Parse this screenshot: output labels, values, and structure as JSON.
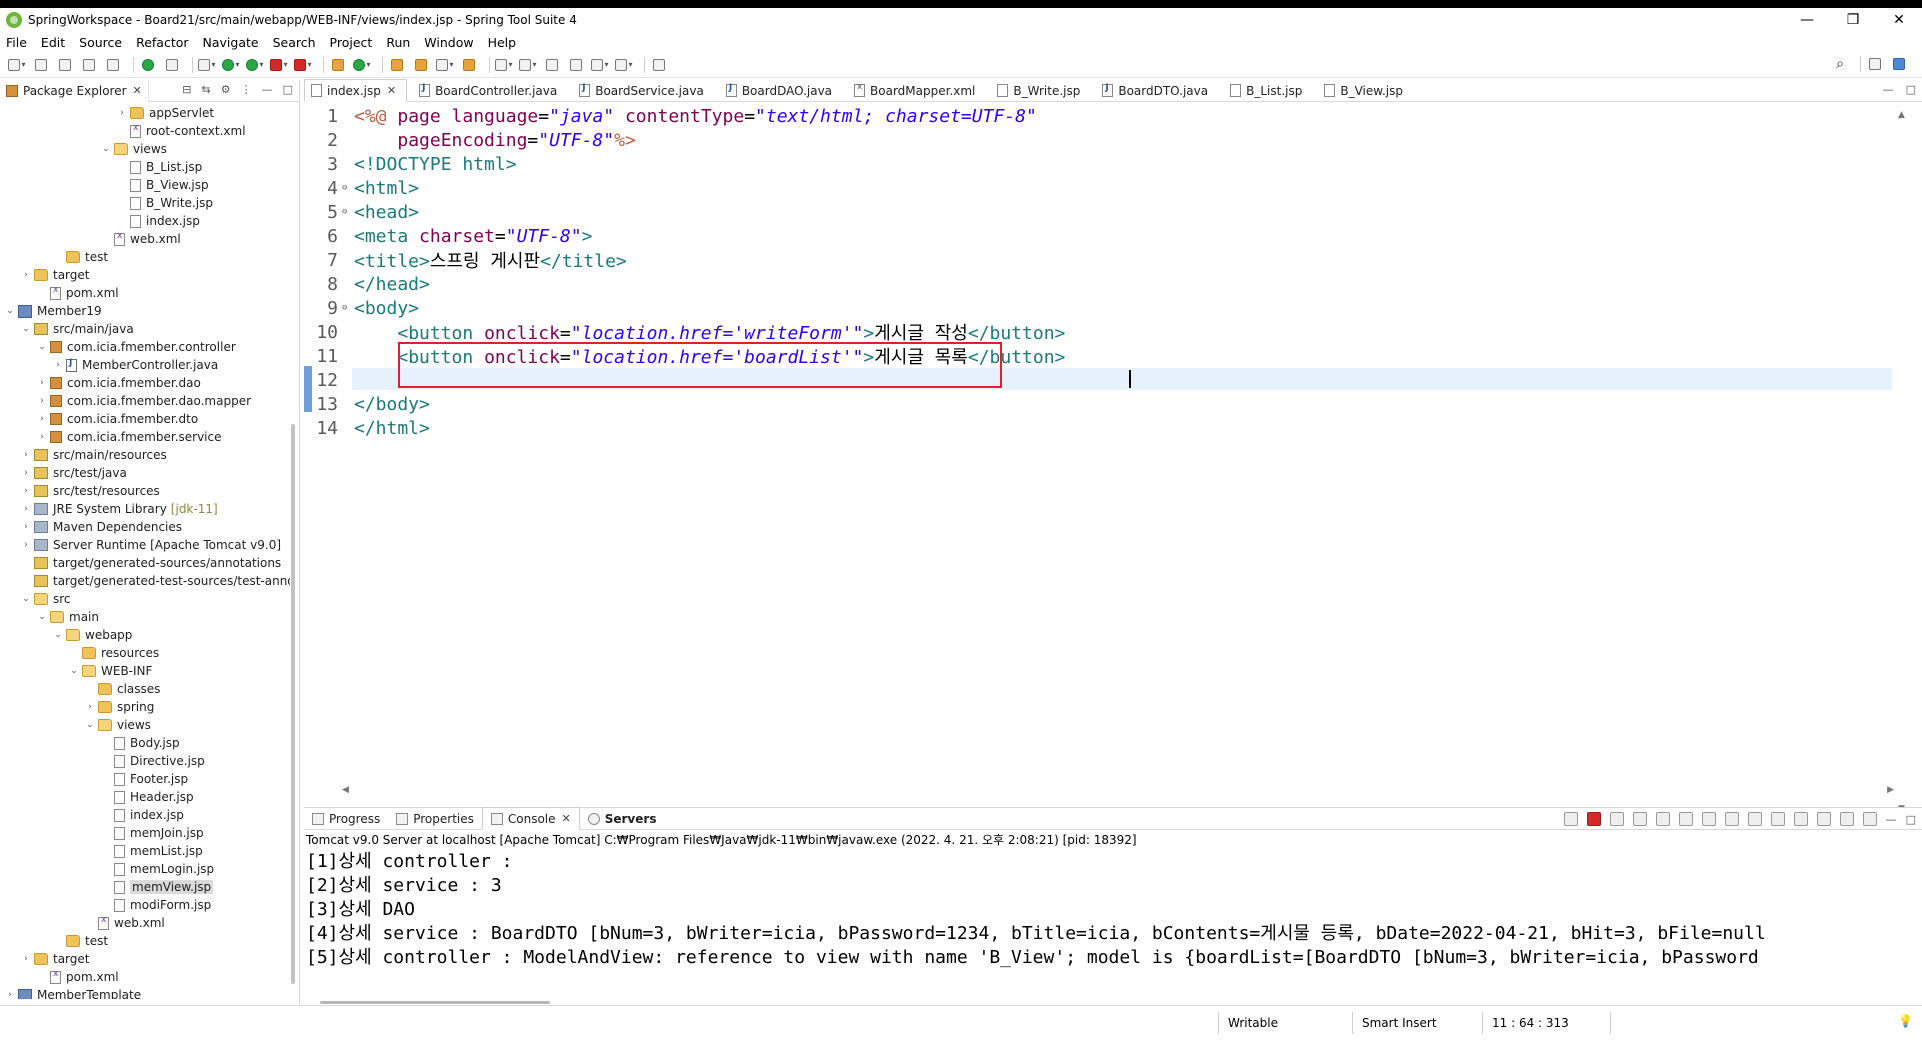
{
  "window": {
    "title": "SpringWorkspace - Board21/src/main/webapp/WEB-INF/views/index.jsp - Spring Tool Suite 4",
    "minimize": "—",
    "maximize": "❐",
    "close": "✕"
  },
  "menu": [
    "File",
    "Edit",
    "Source",
    "Refactor",
    "Navigate",
    "Search",
    "Project",
    "Run",
    "Window",
    "Help"
  ],
  "package_explorer": {
    "tab_label": "Package Explorer",
    "items": [
      {
        "label": "appServlet",
        "indent": 7,
        "twisty": "›",
        "icon": "folder"
      },
      {
        "label": "root-context.xml",
        "indent": 7,
        "twisty": "",
        "icon": "xml"
      },
      {
        "label": "views",
        "indent": 6,
        "twisty": "⌄",
        "icon": "folder-open"
      },
      {
        "label": "B_List.jsp",
        "indent": 7,
        "twisty": "",
        "icon": "file"
      },
      {
        "label": "B_View.jsp",
        "indent": 7,
        "twisty": "",
        "icon": "file"
      },
      {
        "label": "B_Write.jsp",
        "indent": 7,
        "twisty": "",
        "icon": "file"
      },
      {
        "label": "index.jsp",
        "indent": 7,
        "twisty": "",
        "icon": "file"
      },
      {
        "label": "web.xml",
        "indent": 6,
        "twisty": "",
        "icon": "xml"
      },
      {
        "label": "test",
        "indent": 3,
        "twisty": "",
        "icon": "folder"
      },
      {
        "label": "target",
        "indent": 1,
        "twisty": "›",
        "icon": "folder"
      },
      {
        "label": "pom.xml",
        "indent": 2,
        "twisty": "",
        "icon": "xml"
      },
      {
        "label": "Member19",
        "indent": 0,
        "twisty": "⌄",
        "icon": "project"
      },
      {
        "label": "src/main/java",
        "indent": 1,
        "twisty": "⌄",
        "icon": "srcf"
      },
      {
        "label": "com.icia.fmember.controller",
        "indent": 2,
        "twisty": "⌄",
        "icon": "pkg"
      },
      {
        "label": "MemberController.java",
        "indent": 3,
        "twisty": "›",
        "icon": "java"
      },
      {
        "label": "com.icia.fmember.dao",
        "indent": 2,
        "twisty": "›",
        "icon": "pkg"
      },
      {
        "label": "com.icia.fmember.dao.mapper",
        "indent": 2,
        "twisty": "›",
        "icon": "pkg"
      },
      {
        "label": "com.icia.fmember.dto",
        "indent": 2,
        "twisty": "›",
        "icon": "pkg"
      },
      {
        "label": "com.icia.fmember.service",
        "indent": 2,
        "twisty": "›",
        "icon": "pkg"
      },
      {
        "label": "src/main/resources",
        "indent": 1,
        "twisty": "›",
        "icon": "srcf"
      },
      {
        "label": "src/test/java",
        "indent": 1,
        "twisty": "›",
        "icon": "srcf"
      },
      {
        "label": "src/test/resources",
        "indent": 1,
        "twisty": "›",
        "icon": "srcf"
      },
      {
        "label": "JRE System Library",
        "suffix": "[jdk-11]",
        "indent": 1,
        "twisty": "›",
        "icon": "lib"
      },
      {
        "label": "Maven Dependencies",
        "indent": 1,
        "twisty": "›",
        "icon": "lib"
      },
      {
        "label": "Server Runtime [Apache Tomcat v9.0]",
        "indent": 1,
        "twisty": "›",
        "icon": "lib"
      },
      {
        "label": "target/generated-sources/annotations",
        "indent": 1,
        "twisty": "",
        "icon": "srcf"
      },
      {
        "label": "target/generated-test-sources/test-annota",
        "indent": 1,
        "twisty": "",
        "icon": "srcf"
      },
      {
        "label": "src",
        "indent": 1,
        "twisty": "⌄",
        "icon": "folder-open"
      },
      {
        "label": "main",
        "indent": 2,
        "twisty": "⌄",
        "icon": "folder-open"
      },
      {
        "label": "webapp",
        "indent": 3,
        "twisty": "⌄",
        "icon": "folder-open"
      },
      {
        "label": "resources",
        "indent": 4,
        "twisty": "",
        "icon": "folder"
      },
      {
        "label": "WEB-INF",
        "indent": 4,
        "twisty": "⌄",
        "icon": "folder-open"
      },
      {
        "label": "classes",
        "indent": 5,
        "twisty": "",
        "icon": "folder"
      },
      {
        "label": "spring",
        "indent": 5,
        "twisty": "›",
        "icon": "folder"
      },
      {
        "label": "views",
        "indent": 5,
        "twisty": "⌄",
        "icon": "folder-open"
      },
      {
        "label": "Body.jsp",
        "indent": 6,
        "twisty": "",
        "icon": "file"
      },
      {
        "label": "Directive.jsp",
        "indent": 6,
        "twisty": "",
        "icon": "file"
      },
      {
        "label": "Footer.jsp",
        "indent": 6,
        "twisty": "",
        "icon": "file"
      },
      {
        "label": "Header.jsp",
        "indent": 6,
        "twisty": "",
        "icon": "file"
      },
      {
        "label": "index.jsp",
        "indent": 6,
        "twisty": "",
        "icon": "file"
      },
      {
        "label": "memJoin.jsp",
        "indent": 6,
        "twisty": "",
        "icon": "file"
      },
      {
        "label": "memList.jsp",
        "indent": 6,
        "twisty": "",
        "icon": "file"
      },
      {
        "label": "memLogin.jsp",
        "indent": 6,
        "twisty": "",
        "icon": "file"
      },
      {
        "label": "memView.jsp",
        "indent": 6,
        "twisty": "",
        "icon": "file",
        "selected": true
      },
      {
        "label": "modiForm.jsp",
        "indent": 6,
        "twisty": "",
        "icon": "file"
      },
      {
        "label": "web.xml",
        "indent": 5,
        "twisty": "",
        "icon": "xml"
      },
      {
        "label": "test",
        "indent": 3,
        "twisty": "",
        "icon": "folder"
      },
      {
        "label": "target",
        "indent": 1,
        "twisty": "›",
        "icon": "folder"
      },
      {
        "label": "pom.xml",
        "indent": 2,
        "twisty": "",
        "icon": "xml"
      },
      {
        "label": "MemberTemplate",
        "indent": 0,
        "twisty": "›",
        "icon": "project"
      }
    ]
  },
  "editor_tabs": [
    {
      "label": "index.jsp",
      "icon": "file",
      "active": true
    },
    {
      "label": "BoardController.java",
      "icon": "j"
    },
    {
      "label": "BoardService.java",
      "icon": "j"
    },
    {
      "label": "BoardDAO.java",
      "icon": "j"
    },
    {
      "label": "BoardMapper.xml",
      "icon": "x"
    },
    {
      "label": "B_Write.jsp",
      "icon": "file"
    },
    {
      "label": "BoardDTO.java",
      "icon": "j"
    },
    {
      "label": "B_List.jsp",
      "icon": "file"
    },
    {
      "label": "B_View.jsp",
      "icon": "file"
    }
  ],
  "code_lines": [
    {
      "n": "1",
      "fold": "",
      "parts": [
        [
          "jsp",
          "<%@ "
        ],
        [
          "attr",
          "page "
        ],
        [
          "attr",
          "language"
        ],
        [
          "plain",
          "="
        ],
        [
          "str",
          "\"java\""
        ],
        [
          "plain",
          " "
        ],
        [
          "attr",
          "contentType"
        ],
        [
          "plain",
          "="
        ],
        [
          "str",
          "\"text/html; charset=UTF-8\""
        ]
      ]
    },
    {
      "n": "2",
      "fold": "",
      "parts": [
        [
          "plain",
          "    "
        ],
        [
          "attr",
          "pageEncoding"
        ],
        [
          "plain",
          "="
        ],
        [
          "str",
          "\"UTF-8\""
        ],
        [
          "jsp",
          "%>"
        ]
      ]
    },
    {
      "n": "3",
      "fold": "",
      "parts": [
        [
          "tag",
          "<!DOCTYPE html>"
        ]
      ]
    },
    {
      "n": "4",
      "fold": "⊖",
      "parts": [
        [
          "tag",
          "<html>"
        ]
      ]
    },
    {
      "n": "5",
      "fold": "⊖",
      "parts": [
        [
          "tag",
          "<head>"
        ]
      ]
    },
    {
      "n": "6",
      "fold": "",
      "parts": [
        [
          "tag",
          "<meta "
        ],
        [
          "attr",
          "charset"
        ],
        [
          "plain",
          "="
        ],
        [
          "str",
          "\"UTF-8\""
        ],
        [
          "tag",
          ">"
        ]
      ]
    },
    {
      "n": "7",
      "fold": "",
      "parts": [
        [
          "tag",
          "<title>"
        ],
        [
          "plain",
          "스프링 게시판"
        ],
        [
          "tag",
          "</title>"
        ]
      ]
    },
    {
      "n": "8",
      "fold": "",
      "parts": [
        [
          "tag",
          "</head>"
        ]
      ]
    },
    {
      "n": "9",
      "fold": "⊖",
      "parts": [
        [
          "tag",
          "<body>"
        ]
      ]
    },
    {
      "n": "10",
      "fold": "",
      "parts": [
        [
          "plain",
          "    "
        ],
        [
          "tag",
          "<button "
        ],
        [
          "attr",
          "onclick"
        ],
        [
          "plain",
          "="
        ],
        [
          "str",
          "\"location.href='writeForm'\""
        ],
        [
          "tag",
          ">"
        ],
        [
          "plain",
          "게시글 작성"
        ],
        [
          "tag",
          "</button>"
        ]
      ]
    },
    {
      "n": "11",
      "fold": "",
      "parts": [
        [
          "plain",
          "    "
        ],
        [
          "tag",
          "<button "
        ],
        [
          "attr",
          "onclick"
        ],
        [
          "plain",
          "="
        ],
        [
          "str",
          "\"location.href='boardList'\""
        ],
        [
          "tag",
          ">"
        ],
        [
          "plain",
          "게시글 목록"
        ],
        [
          "tag",
          "</button>"
        ]
      ]
    },
    {
      "n": "12",
      "fold": "",
      "parts": []
    },
    {
      "n": "13",
      "fold": "",
      "parts": [
        [
          "tag",
          "</body>"
        ]
      ]
    },
    {
      "n": "14",
      "fold": "",
      "parts": [
        [
          "tag",
          "</html>"
        ]
      ]
    }
  ],
  "bottom_tabs": [
    {
      "label": "Progress"
    },
    {
      "label": "Properties"
    },
    {
      "label": "Console",
      "close": "✕"
    },
    {
      "label": "Servers",
      "bold": true
    }
  ],
  "console": {
    "info": "Tomcat v9.0 Server at localhost [Apache Tomcat] C:₩Program Files₩Java₩jdk-11₩bin₩javaw.exe  (2022. 4. 21. 오후 2:08:21) [pid: 18392]",
    "lines": [
      "[1]상세 controller :",
      "[2]상세 service : 3",
      "[3]상세 DAO",
      "[4]상세 service : BoardDTO [bNum=3, bWriter=icia, bPassword=1234, bTitle=icia, bContents=게시물 등록, bDate=2022-04-21, bHit=3, bFile=null",
      "[5]상세 controller : ModelAndView: reference to view with name 'B_View'; model is {boardList=[BoardDTO [bNum=3, bWriter=icia, bPassword"
    ]
  },
  "status": {
    "writable": "Writable",
    "insert_mode": "Smart Insert",
    "position": "11 : 64 : 313"
  }
}
